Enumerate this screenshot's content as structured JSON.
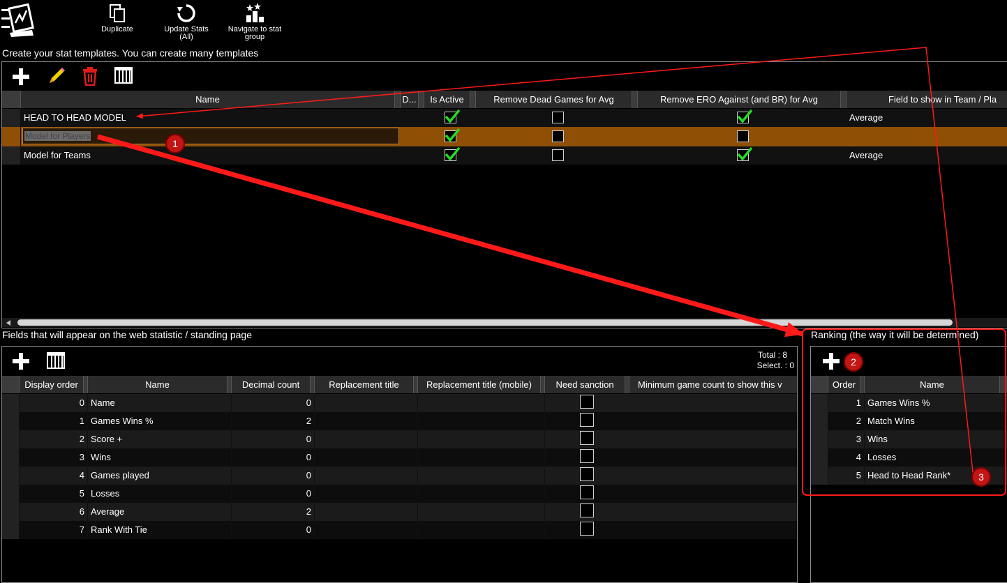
{
  "toolbar": {
    "duplicate_label": "Duplicate",
    "update_stats_label_1": "Update Stats",
    "update_stats_label_2": "(All)",
    "navigate_label_1": "Navigate to stat",
    "navigate_label_2": "group"
  },
  "templates": {
    "title": "Create your stat templates. You can create many templates",
    "columns": [
      "Name",
      "D...",
      "Is Active",
      "Remove Dead Games for Avg",
      "Remove ERO Against (and BR) for Avg",
      "Field to show in Team / Pla"
    ],
    "rows": [
      {
        "name": "HEAD TO HEAD MODEL",
        "is_active": true,
        "remove_dead": false,
        "remove_ero": true,
        "field": "Average"
      },
      {
        "name": "Model for Players",
        "is_active": true,
        "remove_dead": false,
        "remove_ero": false,
        "field": ""
      },
      {
        "name": "Model for Teams",
        "is_active": true,
        "remove_dead": false,
        "remove_ero": true,
        "field": "Average"
      }
    ]
  },
  "fields": {
    "title": "Fields that will appear on the web statistic / standing page",
    "total_label": "Total : 8",
    "select_label": "Select. : 0",
    "columns": [
      "Display order",
      "Name",
      "Decimal count",
      "Replacement title",
      "Replacement title (mobile)",
      "Need sanction",
      "Minimum game count to show this v"
    ],
    "rows": [
      {
        "order": "0",
        "name": "Name",
        "decimals": "0"
      },
      {
        "order": "1",
        "name": "Games Wins %",
        "decimals": "2"
      },
      {
        "order": "2",
        "name": "Score +",
        "decimals": "0"
      },
      {
        "order": "3",
        "name": "Wins",
        "decimals": "0"
      },
      {
        "order": "4",
        "name": "Games played",
        "decimals": "0"
      },
      {
        "order": "5",
        "name": "Losses",
        "decimals": "0"
      },
      {
        "order": "6",
        "name": "Average",
        "decimals": "2"
      },
      {
        "order": "7",
        "name": "Rank With Tie",
        "decimals": "0"
      }
    ]
  },
  "ranking": {
    "title": "Ranking (the way it will be determined)",
    "columns": [
      "Order",
      "Name"
    ],
    "rows": [
      {
        "order": "1",
        "name": "Games Wins %"
      },
      {
        "order": "2",
        "name": "Match Wins"
      },
      {
        "order": "3",
        "name": "Wins"
      },
      {
        "order": "4",
        "name": "Losses"
      },
      {
        "order": "5",
        "name": "Head to Head Rank*"
      }
    ]
  },
  "annotations": {
    "badge_1": "1",
    "badge_2": "2",
    "badge_3": "3",
    "color": "#ff1a1a"
  },
  "colors": {
    "selected_row": "#8f4f05",
    "check_green": "#22dd22",
    "delete_red": "#e01b1b",
    "edit_yellow": "#f0d000"
  }
}
